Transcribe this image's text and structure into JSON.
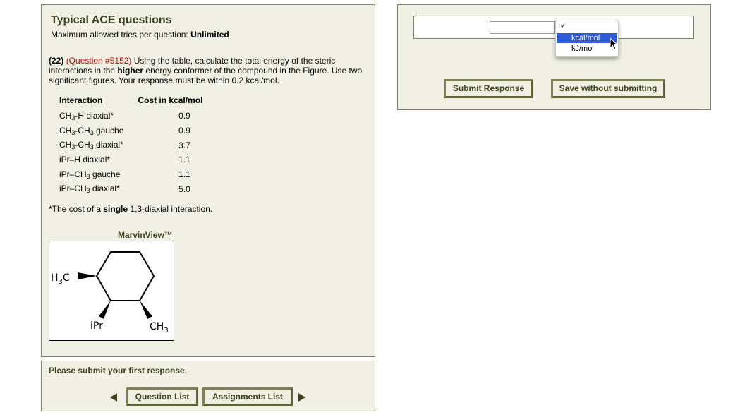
{
  "left_panel": {
    "title": "Typical ACE questions",
    "tries_label": "Maximum allowed tries per question: ",
    "tries_value": "Unlimited",
    "question": {
      "number": "(22)",
      "id": "(Question #5152)",
      "text_before": " Using the table, calculate the total energy of the steric interactions in the ",
      "text_bold": "higher",
      "text_after": " energy conformer of the compound in the Figure. Use two significant figures. Your response must be within 0.2 kcal/mol."
    },
    "table": {
      "headers": [
        "Interaction",
        "Cost in kcal/mol"
      ],
      "rows": [
        {
          "pre": "CH",
          "sub1": "3",
          "mid": "-H diaxial*",
          "sub2": "",
          "post": "",
          "value": "0.9"
        },
        {
          "pre": "CH",
          "sub1": "3",
          "mid": "-CH",
          "sub2": "3",
          "post": " gauche",
          "value": "0.9"
        },
        {
          "pre": "CH",
          "sub1": "3",
          "mid": "-CH",
          "sub2": "3",
          "post": " diaxial*",
          "value": "3.7"
        },
        {
          "pre": "iPr–H diaxial*",
          "sub1": "",
          "mid": "",
          "sub2": "",
          "post": "",
          "value": "1.1"
        },
        {
          "pre": "iPr–CH",
          "sub1": "3",
          "mid": " gauche",
          "sub2": "",
          "post": "",
          "value": "1.1"
        },
        {
          "pre": "iPr–CH",
          "sub1": "3",
          "mid": " diaxial*",
          "sub2": "",
          "post": "",
          "value": "5.0"
        }
      ]
    },
    "footnote": {
      "before": "*The cost of a ",
      "bold": "single",
      "after": " 1,3-diaxial interaction."
    },
    "marvin_label": "MarvinView™",
    "molecule": {
      "left_label": "H",
      "left_sub": "3",
      "left_c": "C",
      "ipr_label": "iPr",
      "ch_label": "CH",
      "ch_sub": "3"
    }
  },
  "right_panel": {
    "input_value": "",
    "submit_label": "Submit Response",
    "save_label": "Save without submitting",
    "dropdown": {
      "check": "✓",
      "options": [
        "kcal/mol",
        "kJ/mol"
      ],
      "selected_index": 0
    }
  },
  "status_panel": {
    "message": "Please submit your first response.",
    "question_list_label": "Question List",
    "assignments_list_label": "Assignments List"
  },
  "colors": {
    "panel_bg": "#f0f1e4",
    "panel_border": "#7d7f5e",
    "heading": "#3c421e",
    "question_id": "#c00000",
    "menu_highlight": "#2f5bd8"
  }
}
